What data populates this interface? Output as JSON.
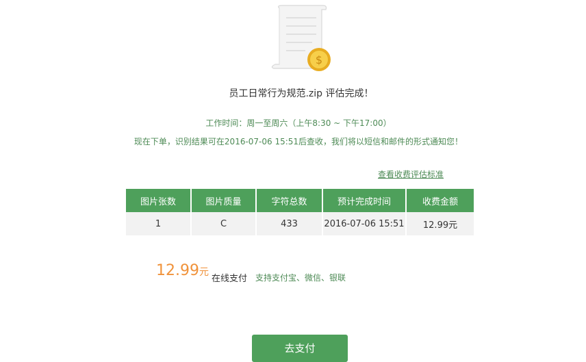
{
  "header": {
    "title": "员工日常行为规范.zip 评估完成！",
    "work_time": "工作时间：周一至周六（上午8:30 ~ 下午17:00）",
    "notice": "现在下单，识别结果可在2016-07-06 15:51后查收，我们将以短信和邮件的形式通知您！"
  },
  "fee_link": "查看收费评估标准",
  "table": {
    "headers": [
      "图片张数",
      "图片质量",
      "字符总数",
      "预计完成时间",
      "收费金额"
    ],
    "row": [
      "1",
      "C",
      "433",
      "2016-07-06 15:51",
      "12.99元"
    ]
  },
  "payment": {
    "amount": "12.99",
    "unit": "元",
    "label": "在线支付",
    "methods": "支持支付宝、微信、银联",
    "button_label": "去支付"
  },
  "colors": {
    "accent_green": "#4ea05b",
    "text_green": "#4d8a55",
    "price_orange": "#f0923a",
    "coin_gold": "#f2c23a"
  },
  "icons": {
    "illustration": "document-scroll-with-dollar-coin-icon"
  }
}
